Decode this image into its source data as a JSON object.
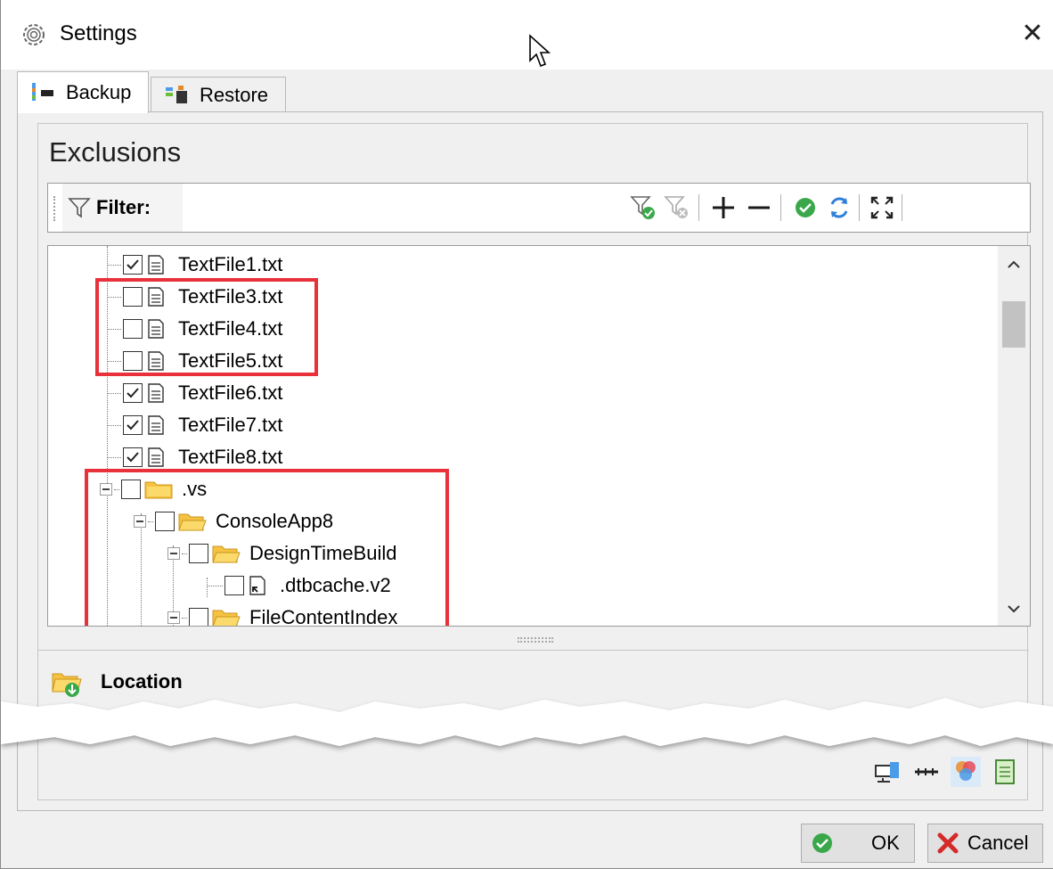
{
  "window": {
    "title": "Settings",
    "close_glyph": "✕",
    "title_icon": "gear-icon"
  },
  "tabs": [
    {
      "label": "Backup",
      "icon": "backup-icon",
      "active": true
    },
    {
      "label": "Restore",
      "icon": "restore-icon",
      "active": false
    }
  ],
  "exclusions": {
    "title": "Exclusions",
    "filter_label": "Filter:",
    "toolbar_icons": [
      "apply-filter-icon",
      "clear-filter-icon",
      "add-icon",
      "remove-icon",
      "check-icon",
      "refresh-icon",
      "expand-all-icon"
    ]
  },
  "tree": {
    "items": [
      {
        "label": "TextFile1.txt",
        "type": "file",
        "checked": true
      },
      {
        "label": "TextFile3.txt",
        "type": "file",
        "checked": false
      },
      {
        "label": "TextFile4.txt",
        "type": "file",
        "checked": false
      },
      {
        "label": "TextFile5.txt",
        "type": "file",
        "checked": false
      },
      {
        "label": "TextFile6.txt",
        "type": "file",
        "checked": true
      },
      {
        "label": "TextFile7.txt",
        "type": "file",
        "checked": true
      },
      {
        "label": "TextFile8.txt",
        "type": "file",
        "checked": true
      },
      {
        "label": ".vs",
        "type": "folder",
        "checked": false,
        "expanded": true
      },
      {
        "label": "ConsoleApp8",
        "type": "folder",
        "checked": false,
        "expanded": true
      },
      {
        "label": "DesignTimeBuild",
        "type": "folder",
        "checked": false,
        "expanded": true
      },
      {
        "label": ".dtbcache.v2",
        "type": "shortcut",
        "checked": false
      },
      {
        "label": "FileContentIndex",
        "type": "folder",
        "checked": false,
        "expanded": true
      }
    ]
  },
  "location": {
    "title": "Location",
    "icon": "folder-download-icon"
  },
  "footer": {
    "ok_label": "OK",
    "cancel_label": "Cancel"
  },
  "colors": {
    "highlight": "#e8313a",
    "folder": "#f5c242",
    "window_bg": "#f0f0f0"
  }
}
